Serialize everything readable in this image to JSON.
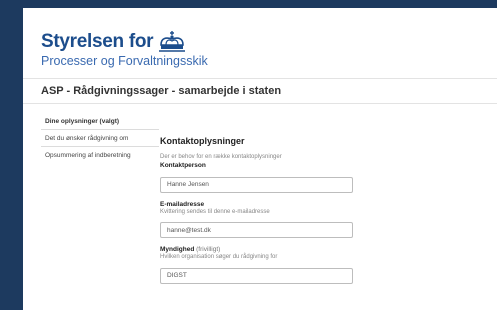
{
  "brand": {
    "name": "Styrelsen for",
    "subtitle": "Processer og Forvaltningsskik"
  },
  "page_title": "ASP - Rådgivningssager - samarbejde i staten",
  "sidebar": {
    "items": [
      {
        "label": "Dine oplysninger (valgt)"
      },
      {
        "label": "Det du ønsker rådgivning om"
      },
      {
        "label": "Opsummering af indberetning"
      }
    ]
  },
  "form": {
    "section_title": "Kontaktoplysninger",
    "intro": "Der er behov for en række kontaktoplysninger",
    "contact": {
      "label": "Kontaktperson",
      "value": "Hanne Jensen"
    },
    "email": {
      "label": "E-mailadresse",
      "helper": "Kvittering sendes til denne e-mailadresse",
      "value": "hanne@test.dk"
    },
    "authority": {
      "label": "Myndighed",
      "optional": "(frivilligt)",
      "helper": "Hvilken organisation søger du rådgivning for",
      "value": "DIGST"
    }
  },
  "colors": {
    "brand": "#1c4d8c",
    "background": "#1d3a5f"
  }
}
